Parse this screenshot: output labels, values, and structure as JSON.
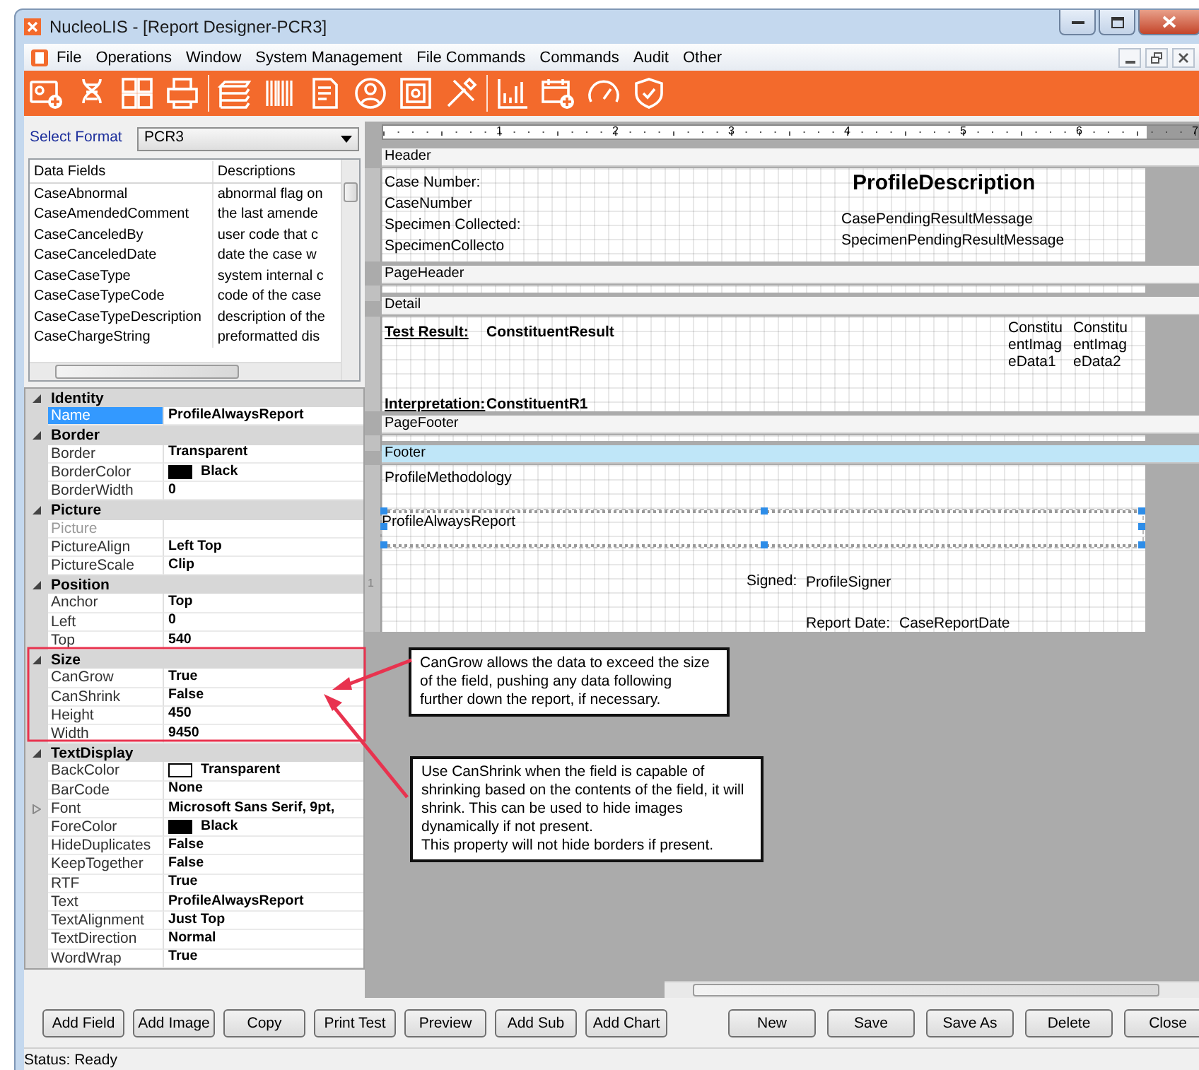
{
  "window": {
    "title": "NucleoLIS - [Report Designer-PCR3]"
  },
  "menu": [
    "File",
    "Operations",
    "Window",
    "System Management",
    "File Commands",
    "Commands",
    "Audit",
    "Other"
  ],
  "select_format": {
    "label": "Select Format",
    "value": "PCR3"
  },
  "data_fields": {
    "columns": [
      "Data Fields",
      "Descriptions"
    ],
    "rows": [
      [
        "CaseAbnormal",
        "abnormal flag on"
      ],
      [
        "CaseAmendedComment",
        "the last amende"
      ],
      [
        "CaseCanceledBy",
        "user code that c"
      ],
      [
        "CaseCanceledDate",
        "date the case w"
      ],
      [
        "CaseCaseType",
        "system internal c"
      ],
      [
        "CaseCaseTypeCode",
        "code of the case"
      ],
      [
        "CaseCaseTypeDescription",
        "description of the"
      ],
      [
        "CaseChargeString",
        "preformatted dis"
      ]
    ]
  },
  "properties": [
    {
      "category": "Identity",
      "expanded": true,
      "items": [
        {
          "name": "Name",
          "value": "ProfileAlwaysReport",
          "selected": true,
          "disabled": false,
          "expandable": false
        }
      ]
    },
    {
      "category": "Border",
      "expanded": true,
      "items": [
        {
          "name": "Border",
          "value": "Transparent",
          "selected": false,
          "disabled": false,
          "expandable": false
        },
        {
          "name": "BorderColor",
          "value": "Black",
          "color": "#000000",
          "selected": false,
          "disabled": false,
          "expandable": false
        },
        {
          "name": "BorderWidth",
          "value": "0",
          "selected": false,
          "disabled": false,
          "expandable": false
        }
      ]
    },
    {
      "category": "Picture",
      "expanded": true,
      "items": [
        {
          "name": "Picture",
          "selected": false,
          "disabled": true,
          "expandable": false
        },
        {
          "name": "PictureAlign",
          "value": "Left Top",
          "selected": false,
          "disabled": false,
          "expandable": false
        },
        {
          "name": "PictureScale",
          "value": "Clip",
          "selected": false,
          "disabled": false,
          "expandable": false
        }
      ]
    },
    {
      "category": "Position",
      "expanded": true,
      "items": [
        {
          "name": "Anchor",
          "value": "Top",
          "selected": false,
          "disabled": false,
          "expandable": false
        },
        {
          "name": "Left",
          "value": "0",
          "selected": false,
          "disabled": false,
          "expandable": false
        },
        {
          "name": "Top",
          "value": "540",
          "selected": false,
          "disabled": false,
          "expandable": false
        }
      ]
    },
    {
      "category": "Size",
      "expanded": true,
      "items": [
        {
          "name": "CanGrow",
          "value": "True",
          "selected": false,
          "disabled": false,
          "expandable": false
        },
        {
          "name": "CanShrink",
          "value": "False",
          "selected": false,
          "disabled": false,
          "expandable": false
        },
        {
          "name": "Height",
          "value": "450",
          "selected": false,
          "disabled": false,
          "expandable": false
        },
        {
          "name": "Width",
          "value": "9450",
          "selected": false,
          "disabled": false,
          "expandable": false
        }
      ]
    },
    {
      "category": "TextDisplay",
      "expanded": true,
      "items": [
        {
          "name": "BackColor",
          "value": "Transparent",
          "color": "#ffffff",
          "selected": false,
          "disabled": false,
          "expandable": false
        },
        {
          "name": "BarCode",
          "value": "None",
          "selected": false,
          "disabled": false,
          "expandable": false
        },
        {
          "name": "Font",
          "value": "Microsoft Sans Serif, 9pt,",
          "selected": false,
          "disabled": false,
          "expandable": true
        },
        {
          "name": "ForeColor",
          "value": "Black",
          "color": "#000000",
          "selected": false,
          "disabled": false,
          "expandable": false
        },
        {
          "name": "HideDuplicates",
          "value": "False",
          "selected": false,
          "disabled": false,
          "expandable": false
        },
        {
          "name": "KeepTogether",
          "value": "False",
          "selected": false,
          "disabled": false,
          "expandable": false
        },
        {
          "name": "RTF",
          "value": "True",
          "selected": false,
          "disabled": false,
          "expandable": false
        },
        {
          "name": "Text",
          "value": "ProfileAlwaysReport",
          "selected": false,
          "disabled": false,
          "expandable": false
        },
        {
          "name": "TextAlignment",
          "value": "Just Top",
          "selected": false,
          "disabled": false,
          "expandable": false
        },
        {
          "name": "TextDirection",
          "value": "Normal",
          "selected": false,
          "disabled": false,
          "expandable": false
        },
        {
          "name": "WordWrap",
          "value": "True",
          "selected": false,
          "disabled": false,
          "expandable": false
        }
      ]
    }
  ],
  "designer": {
    "ruler": [
      "1",
      "2",
      "3",
      "4",
      "5",
      "6",
      "7"
    ],
    "sections": [
      {
        "name": "Header",
        "selected": false,
        "fields": [
          {
            "kind": "text",
            "text": "Case Number:",
            "selected": false
          },
          {
            "kind": "text",
            "text": "CaseNumber",
            "selected": false
          },
          {
            "kind": "text",
            "text": "Specimen Collected:",
            "selected": false
          },
          {
            "kind": "text",
            "text": "SpecimenCollecto",
            "selected": false
          },
          {
            "kind": "heading",
            "text": "ProfileDescription",
            "selected": false
          },
          {
            "kind": "text",
            "text": "CasePendingResultMessage",
            "selected": false
          },
          {
            "kind": "text",
            "text": "SpecimenPendingResultMessage",
            "selected": false
          }
        ]
      },
      {
        "name": "PageHeader",
        "selected": false
      },
      {
        "name": "Detail",
        "selected": false,
        "fields": [
          {
            "kind": "caption",
            "text": "Test Result:",
            "selected": false
          },
          {
            "kind": "value",
            "text": "ConstituentResult",
            "selected": false
          },
          {
            "kind": "wrap",
            "text": "ConstituentImageData1",
            "selected": false
          },
          {
            "kind": "wrap",
            "text": "ConstituentImageData2",
            "selected": false
          },
          {
            "kind": "caption",
            "text": "Interpretation:",
            "selected": false
          },
          {
            "kind": "value",
            "text": "ConstituentR1",
            "selected": false
          }
        ]
      },
      {
        "name": "PageFooter",
        "selected": false
      },
      {
        "name": "Footer",
        "selected": true,
        "ruler_marks": [
          "1"
        ],
        "fields": [
          {
            "kind": "text",
            "text": "ProfileMethodology",
            "selected": false
          },
          {
            "kind": "text",
            "text": "ProfileAlwaysReport",
            "selected": true
          },
          {
            "kind": "text",
            "text": "Signed:",
            "selected": false
          },
          {
            "kind": "text",
            "text": "ProfileSigner",
            "selected": false
          },
          {
            "kind": "text",
            "text": "Report Date:",
            "selected": false
          },
          {
            "kind": "text",
            "text": "CaseReportDate",
            "selected": false
          }
        ]
      }
    ]
  },
  "callouts": [
    {
      "paragraphs": [
        "CanGrow allows the data to exceed the size of the field, pushing any data following further down the report, if necessary."
      ]
    },
    {
      "paragraphs": [
        "Use CanShrink when the field is capable of shrinking based on the contents of the field, it will shrink. This can be used to hide images dynamically if not present.",
        "This property will not hide borders if present."
      ]
    }
  ],
  "buttons_left": [
    "Add Field",
    "Add Image",
    "Copy",
    "Print Test",
    "Preview",
    "Add Sub",
    "Add Chart"
  ],
  "buttons_right": [
    "New",
    "Save",
    "Save As",
    "Delete",
    "Close"
  ],
  "status_bar": "Status: Ready"
}
